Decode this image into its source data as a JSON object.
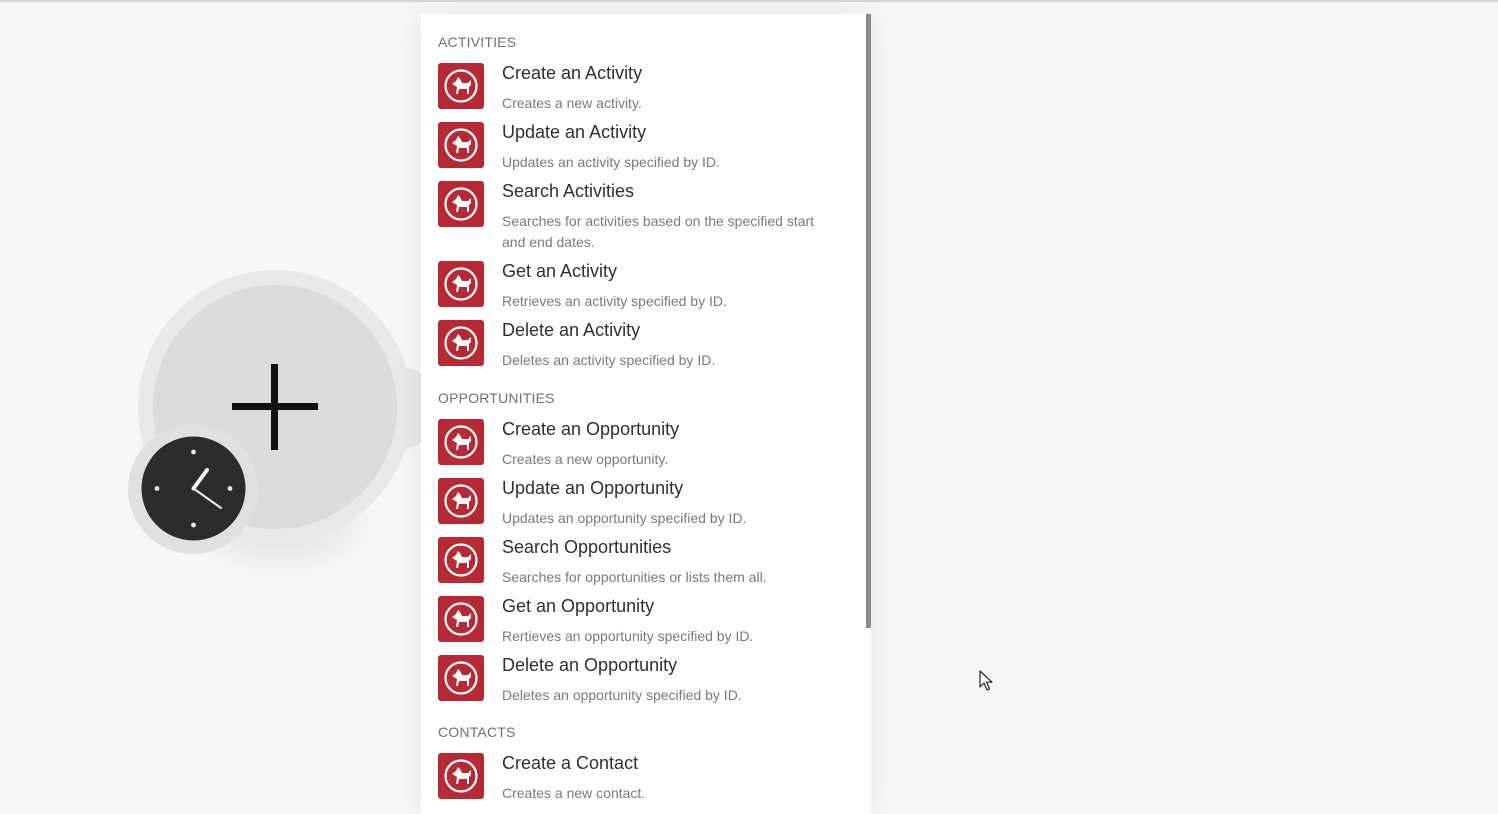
{
  "sections": [
    {
      "title": "ACTIVITIES",
      "items": [
        {
          "title": "Create an Activity",
          "desc": "Creates a new activity."
        },
        {
          "title": "Update an Activity",
          "desc": "Updates an activity specified by ID."
        },
        {
          "title": "Search Activities",
          "desc": "Searches for activities based on the specified start and end dates."
        },
        {
          "title": "Get an Activity",
          "desc": "Retrieves an activity specified by ID."
        },
        {
          "title": "Delete an Activity",
          "desc": "Deletes an activity specified by ID."
        }
      ]
    },
    {
      "title": "OPPORTUNITIES",
      "items": [
        {
          "title": "Create an Opportunity",
          "desc": "Creates a new opportunity."
        },
        {
          "title": "Update an Opportunity",
          "desc": "Updates an opportunity specified by ID."
        },
        {
          "title": "Search Opportunities",
          "desc": "Searches for opportunities or lists them all."
        },
        {
          "title": "Get an Opportunity",
          "desc": "Rertieves an opportunity specified by ID."
        },
        {
          "title": "Delete an Opportunity",
          "desc": "Deletes an opportunity specified by ID."
        }
      ]
    },
    {
      "title": "CONTACTS",
      "items": [
        {
          "title": "Create a Contact",
          "desc": "Creates a new contact."
        }
      ]
    }
  ],
  "icons": {
    "app_icon": "dog-logo-icon",
    "add_module": "plus-icon",
    "schedule": "clock-icon"
  },
  "colors": {
    "app_icon_bg": "#b52a34",
    "clock_bg": "#2b2b2b"
  }
}
